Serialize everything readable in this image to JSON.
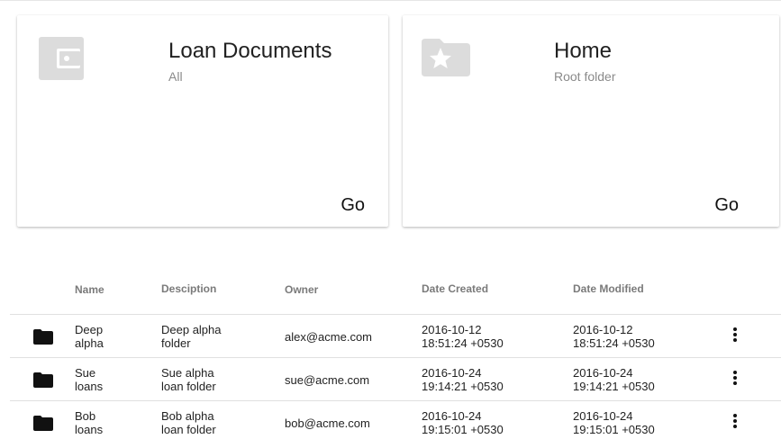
{
  "cards": [
    {
      "title": "Loan Documents",
      "subtitle": "All",
      "action": "Go",
      "icon": "wallet-icon"
    },
    {
      "title": "Home",
      "subtitle": "Root folder",
      "action": "Go",
      "icon": "folder-star-icon"
    }
  ],
  "table": {
    "headers": [
      "Name",
      "Desciption",
      "Owner",
      "Date Created",
      "Date Modified"
    ],
    "rows": [
      {
        "name": [
          "Deep",
          "alpha"
        ],
        "description": [
          "Deep alpha",
          "folder"
        ],
        "owner": "alex@acme.com",
        "created": [
          "2016-10-12",
          "18:51:24 +0530"
        ],
        "modified": [
          "2016-10-12",
          "18:51:24 +0530"
        ]
      },
      {
        "name": [
          "Sue",
          "loans"
        ],
        "description": [
          "Sue alpha",
          "loan folder"
        ],
        "owner": "sue@acme.com",
        "created": [
          "2016-10-24",
          "19:14:21 +0530"
        ],
        "modified": [
          "2016-10-24",
          "19:14:21 +0530"
        ]
      },
      {
        "name": [
          "Bob",
          "loans"
        ],
        "description": [
          "Bob alpha",
          "loan folder"
        ],
        "owner": "bob@acme.com",
        "created": [
          "2016-10-24",
          "19:15:01 +0530"
        ],
        "modified": [
          "2016-10-24",
          "19:15:01 +0530"
        ]
      }
    ]
  },
  "icons": {
    "row_icon": "folder-icon",
    "row_menu": "more-vert-icon"
  },
  "colors": {
    "icon_gray": "#dcdcdc",
    "header_gray": "#7a7a7a"
  }
}
